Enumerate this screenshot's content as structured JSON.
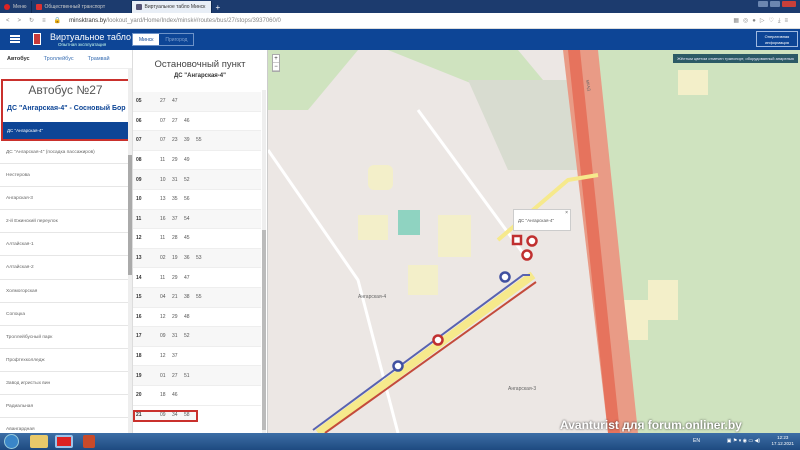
{
  "browser": {
    "tabs": [
      {
        "label": "Меню"
      },
      {
        "label": "Общественный транспорт"
      },
      {
        "label": "Виртуальное табло Минск"
      }
    ],
    "new_tab": "+",
    "url_domain": "minsktrans.by",
    "url_path": "/lookout_yard/Home/Index/minsk#/routes/bus/27/stops/3937060/0"
  },
  "header": {
    "title": "Виртуальное табло",
    "subtitle": "Опытная эксплуатация",
    "cities": [
      "Минск",
      "Пригород"
    ],
    "operative_info": "Оперативная информация"
  },
  "modes": [
    "Автобус",
    "Троллейбус",
    "Трамвай"
  ],
  "route": {
    "number": "Автобус №27",
    "name": "ДС \"Ангарская-4\" - Сосновый Бор",
    "selected_stop": "ДС \"Ангарская-4\""
  },
  "stops": [
    "ДС \"Ангарская-4\" (посадка пассажиров)",
    "Нестерова",
    "Ангарская-3",
    "2-й Ежинский переулок",
    "Алтайская-1",
    "Алтайская-2",
    "Холмогорская",
    "Сопоцка",
    "Троллейбусный парк",
    "Профтехколледж",
    "Завод игристых вин",
    "Радиальная",
    "Авангардная"
  ],
  "timetable": {
    "title": "Остановочный пункт",
    "stop": "ДС \"Ангарская-4\"",
    "rows": [
      {
        "hour": "05",
        "minutes": [
          "27",
          "47"
        ]
      },
      {
        "hour": "06",
        "minutes": [
          "07",
          "27",
          "46"
        ]
      },
      {
        "hour": "07",
        "minutes": [
          "07",
          "23",
          "39",
          "55"
        ]
      },
      {
        "hour": "08",
        "minutes": [
          "11",
          "29",
          "49"
        ]
      },
      {
        "hour": "09",
        "minutes": [
          "10",
          "31",
          "52"
        ]
      },
      {
        "hour": "10",
        "minutes": [
          "13",
          "35",
          "56"
        ]
      },
      {
        "hour": "11",
        "minutes": [
          "16",
          "37",
          "54"
        ]
      },
      {
        "hour": "12",
        "minutes": [
          "11",
          "28",
          "45"
        ]
      },
      {
        "hour": "13",
        "minutes": [
          "02",
          "19",
          "36",
          "53"
        ]
      },
      {
        "hour": "14",
        "minutes": [
          "11",
          "29",
          "47"
        ]
      },
      {
        "hour": "15",
        "minutes": [
          "04",
          "21",
          "38",
          "55"
        ]
      },
      {
        "hour": "16",
        "minutes": [
          "12",
          "29",
          "48"
        ]
      },
      {
        "hour": "17",
        "minutes": [
          "09",
          "31",
          "52"
        ]
      },
      {
        "hour": "18",
        "minutes": [
          "12",
          "37"
        ]
      },
      {
        "hour": "19",
        "minutes": [
          "01",
          "27",
          "51"
        ]
      },
      {
        "hour": "20",
        "minutes": [
          "18",
          "46"
        ]
      },
      {
        "hour": "21",
        "minutes": [
          "09",
          "34",
          "58"
        ]
      }
    ]
  },
  "map": {
    "zoom_in": "+",
    "zoom_out": "−",
    "legend": "Жёлтым цветом отмечен транспорт, оборудованный апарелью",
    "popup": "ДС \"Ангарская-4\"",
    "popup_close": "×",
    "labels": [
      "Ангарская-4",
      "Ангарская-3",
      "МКАД"
    ]
  },
  "watermark": "Avanturist для forum.onliner.by",
  "taskbar": {
    "lang": "EN",
    "time": "12:23",
    "date": "17.12.2021"
  }
}
